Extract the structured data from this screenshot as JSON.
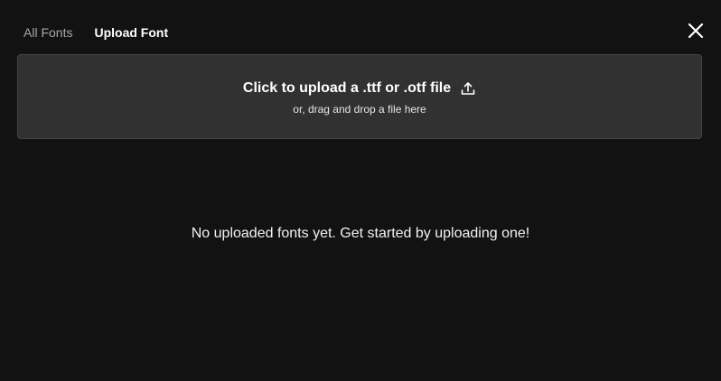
{
  "tabs": [
    {
      "label": "All Fonts",
      "active": false
    },
    {
      "label": "Upload Font",
      "active": true
    }
  ],
  "close_icon": "close-icon",
  "upload": {
    "title": "Click to upload a .ttf or .otf file",
    "subtitle": "or, drag and drop a file here",
    "icon": "upload-icon"
  },
  "empty_message": "No uploaded fonts yet. Get started by uploading one!",
  "colors": {
    "background": "#121212",
    "upload_zone": "#313131",
    "inactive_tab": "#a8a8a8",
    "text": "#ffffff"
  }
}
